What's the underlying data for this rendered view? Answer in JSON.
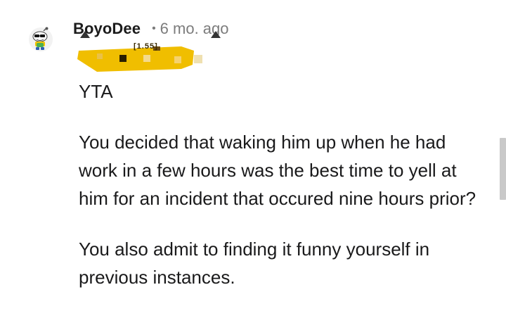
{
  "comment": {
    "username": "BoyoDee",
    "separator": "•",
    "timestamp": "6 mo. ago",
    "flair_text": "[1.55]",
    "paragraphs": [
      "YTA",
      "You decided that waking him up when he had work in a few hours was the best time to yell at him for an incident that occured nine hours prior?",
      "You also admit to finding it funny yourself in previous instances."
    ]
  },
  "colors": {
    "flair_background": "#f0be00",
    "meta_text": "#7c7c7c",
    "body_text": "#1a1a1b",
    "scrollbar": "#c9c9c9"
  },
  "icons": {
    "avatar": "snoo-avatar-sunglasses-icon"
  }
}
